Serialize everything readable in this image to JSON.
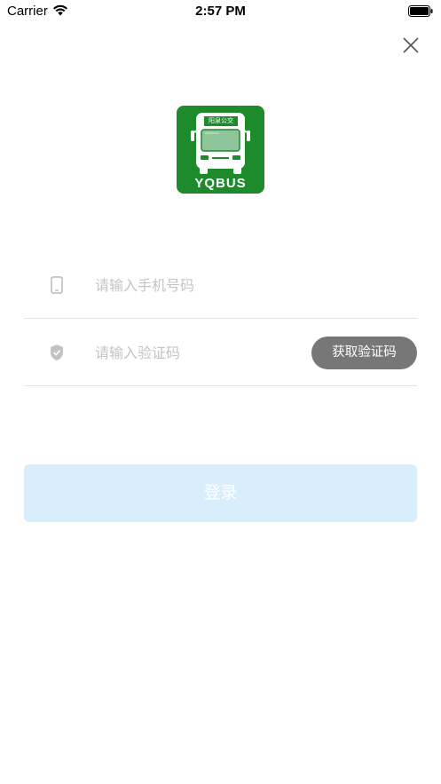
{
  "status_bar": {
    "carrier": "Carrier",
    "time": "2:57 PM",
    "icons": [
      "wifi-icon",
      "battery-icon"
    ]
  },
  "close": {
    "icon": "close-icon"
  },
  "logo": {
    "sign_text": "阳泉公交",
    "brand_text": "YQBUS",
    "color": "#1d8a2c"
  },
  "form": {
    "phone": {
      "placeholder": "请输入手机号码",
      "value": "",
      "icon": "phone-icon"
    },
    "code": {
      "placeholder": "请输入验证码",
      "value": "",
      "icon": "shield-check-icon"
    },
    "get_code_label": "获取验证码",
    "login_label": "登录"
  },
  "colors": {
    "get_code_bg": "#777777",
    "login_bg": "#d9eefc",
    "placeholder": "#c4c4c4",
    "divider": "#e3e3e3"
  }
}
